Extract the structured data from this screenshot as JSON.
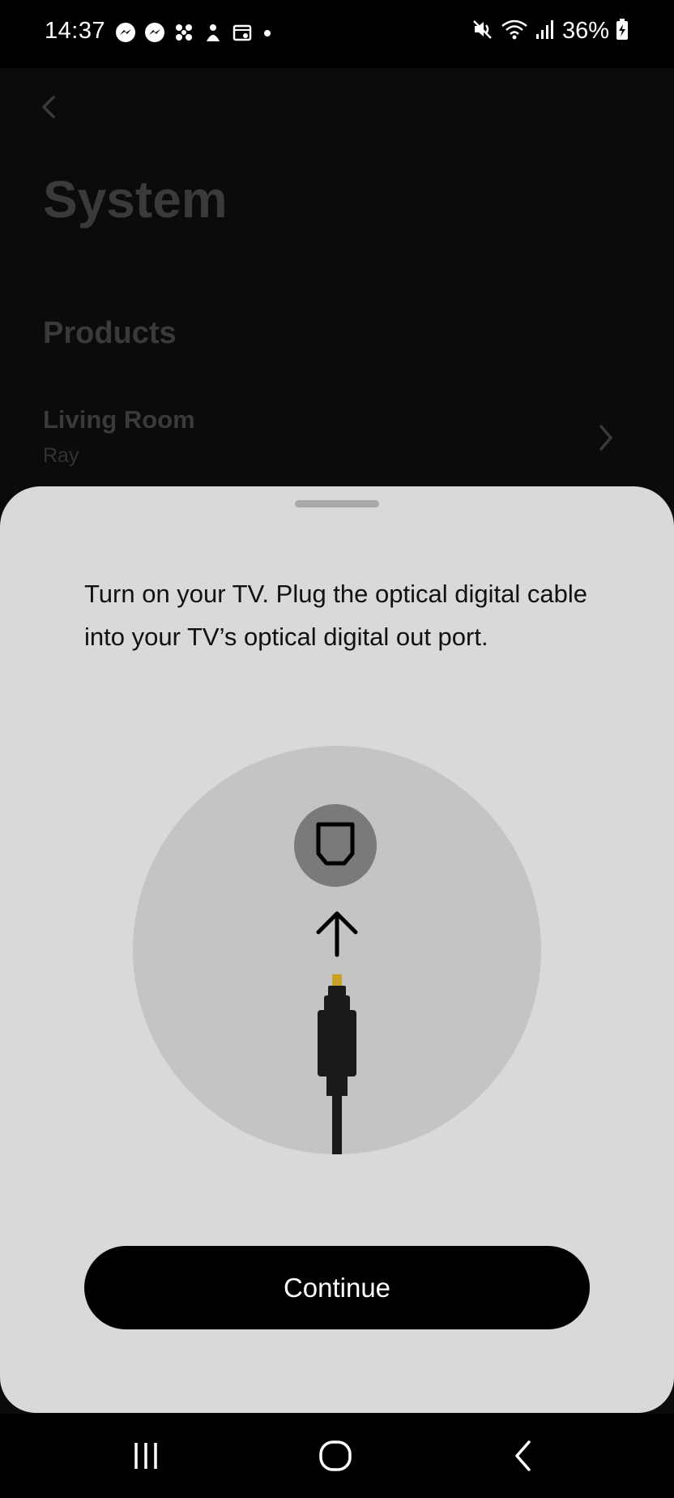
{
  "status_bar": {
    "time": "14:37",
    "battery": "36%",
    "left_icons": [
      "messenger-icon",
      "messenger-icon",
      "app-icon",
      "app-icon",
      "calendar-icon",
      "dot-icon"
    ],
    "right_icons": [
      "mute-icon",
      "wifi-icon",
      "signal-icon",
      "battery-charging-icon"
    ]
  },
  "background_page": {
    "title": "System",
    "section": "Products",
    "product": {
      "name": "Living Room",
      "model": "Ray"
    }
  },
  "sheet": {
    "instruction": "Turn on your TV. Plug the optical digital cable into your TV’s optical digital out port.",
    "illustration": "optical-cable-into-port",
    "continue_label": "Continue"
  },
  "nav_bar": {
    "buttons": [
      "recent-apps",
      "home",
      "back"
    ]
  },
  "colors": {
    "sheet_bg": "#d9d9d9",
    "circle_bg": "#c4c4c4",
    "button_bg": "#000000",
    "button_text": "#ffffff"
  }
}
